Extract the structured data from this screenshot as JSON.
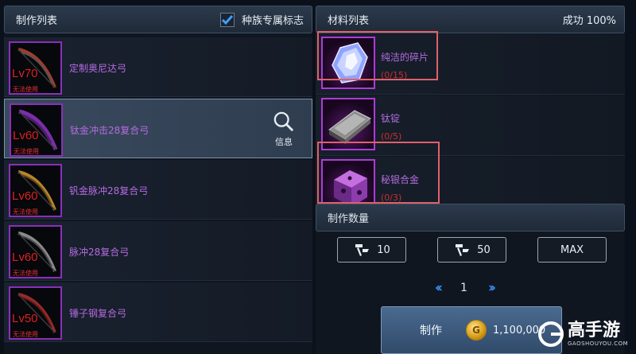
{
  "left_panel": {
    "title": "制作列表",
    "race_checkbox_label": "种族专属标志",
    "items": [
      {
        "name": "定制奥尼达弓",
        "level": "Lv70",
        "status": "无法使用",
        "rim": "#a13b2a"
      },
      {
        "name": "钛金冲击28复合弓",
        "level": "Lv60",
        "status": "无法使用",
        "rim": "#7a2ea8"
      },
      {
        "name": "钒金脉冲28复合弓",
        "level": "Lv60",
        "status": "无法使用",
        "rim": "#b8862a"
      },
      {
        "name": "脉冲28复合弓",
        "level": "Lv60",
        "status": "无法使用",
        "rim": "#8b8b8b"
      },
      {
        "name": "锤子钢复合弓",
        "level": "Lv50",
        "status": "无法使用",
        "rim": "#9a2a2a"
      }
    ],
    "info_label": "信息"
  },
  "right_panel": {
    "title": "材料列表",
    "success": "成功 100%",
    "materials": [
      {
        "name": "纯洁的碎片",
        "count": "(0/15)"
      },
      {
        "name": "钛锭",
        "count": "(0/5)"
      },
      {
        "name": "秘银合金",
        "count": "(0/3)"
      }
    ],
    "quantity_title": "制作数量",
    "qty_buttons": {
      "ten": "10",
      "fifty": "50",
      "max": "MAX"
    },
    "page": "1",
    "craft_label": "制作",
    "price": "1,100,000"
  },
  "watermark": {
    "big": "高手游",
    "small": "GAOSHOUYOU.COM"
  },
  "colors": {
    "accent_purple": "#b46be0",
    "warning_red": "#c93030",
    "link_blue": "#3a8ef0"
  }
}
